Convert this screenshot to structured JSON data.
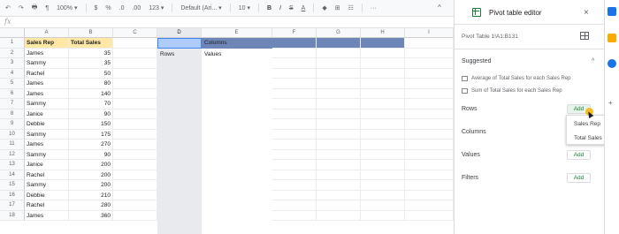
{
  "toolbar": {
    "undo": "↶",
    "redo": "↷",
    "print": "🖶",
    "paint_format": "¶",
    "zoom": "100%",
    "currency": "$",
    "percent": "%",
    "dec_decrease": ".0",
    "dec_increase": ".00",
    "more_formats": "123",
    "font": "Default (Ari...",
    "font_size": "10",
    "bold": "B",
    "italic": "I",
    "strike": "S",
    "text_color": "A",
    "more": "···",
    "collapse": "^"
  },
  "formula_bar": {
    "fx": "fx"
  },
  "grid": {
    "columns": [
      "A",
      "B",
      "C",
      "D",
      "E",
      "F",
      "G",
      "H",
      "I"
    ],
    "rows": [
      "1",
      "2",
      "3",
      "4",
      "5",
      "6",
      "7",
      "8",
      "9",
      "10",
      "11",
      "12",
      "13",
      "14",
      "15",
      "16",
      "17",
      "18"
    ],
    "header": {
      "rep": "Sales Rep",
      "total": "Total Sales"
    },
    "data": [
      [
        "James",
        "35"
      ],
      [
        "Sammy",
        "35"
      ],
      [
        "Rachel",
        "50"
      ],
      [
        "James",
        "80"
      ],
      [
        "James",
        "140"
      ],
      [
        "Sammy",
        "70"
      ],
      [
        "Janice",
        "90"
      ],
      [
        "Debbie",
        "150"
      ],
      [
        "Sammy",
        "175"
      ],
      [
        "James",
        "270"
      ],
      [
        "Sammy",
        "90"
      ],
      [
        "Janice",
        "200"
      ],
      [
        "Rachel",
        "200"
      ],
      [
        "Sammy",
        "200"
      ],
      [
        "Debbie",
        "210"
      ],
      [
        "Rachel",
        "280"
      ],
      [
        "James",
        "360"
      ]
    ],
    "pivot": {
      "columns": "Columns",
      "rows": "Rows",
      "values": "Values"
    }
  },
  "panel": {
    "title": "Pivot table editor",
    "close": "×",
    "range": "Pivot Table 1!A1:B131",
    "suggested": "Suggested",
    "suggest_chevron": "^",
    "suggestions": [
      "Average of Total Sales for each Sales Rep",
      "Sum of Total Sales for each Sales Rep"
    ],
    "rows_label": "Rows",
    "columns_label": "Columns",
    "values_label": "Values",
    "filters_label": "Filters",
    "add": "Add",
    "dropdown": [
      "Sales Rep",
      "Total Sales"
    ]
  },
  "colors": {
    "pivot_header": "#6e86b7",
    "header_fill": "#ffe8a6",
    "accent_green": "#188038",
    "cursor_highlight": "#f5b400"
  }
}
